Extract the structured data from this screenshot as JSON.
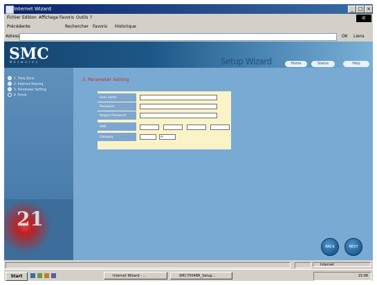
{
  "window": {
    "title": "Internet Wizard",
    "min": "_",
    "max": "□",
    "close": "×"
  },
  "menu": [
    "Fichier",
    "Edition",
    "Affichage",
    "Favoris",
    "Outils",
    "?"
  ],
  "ie_badge": "IE",
  "toolbar": {
    "back": "Précédente",
    "search": "Rechercher",
    "favorites": "Favoris",
    "history": "Historique"
  },
  "address": {
    "label": "Adresse",
    "go": "OK",
    "links": "Liens"
  },
  "banner": {
    "logo": "SMC",
    "subtitle": "Networks",
    "setup_title": "Setup Wizard",
    "tabs": [
      "Home",
      "Status",
      "Help"
    ]
  },
  "steps": [
    {
      "label": "1. Time Zone"
    },
    {
      "label": "2. Internet Sharing"
    },
    {
      "label": "3. Parameter Setting"
    },
    {
      "label": "4. Finish"
    }
  ],
  "page": {
    "heading": "3. Parameter Setting"
  },
  "form": {
    "fields": [
      {
        "label": "User name",
        "value": ""
      },
      {
        "label": "Password",
        "value": ""
      },
      {
        "label": "Retype Password",
        "value": ""
      }
    ],
    "dns_label": "DNS",
    "gateway_label": "Gateway",
    "gateway_value": "m"
  },
  "nav": {
    "back": "BACK",
    "next": "NEXT"
  },
  "status": {
    "zone": "Internet"
  },
  "taskbar": {
    "start": "Start",
    "tasks": [
      "Internet Wizard - ...",
      "SMC7004BR_Setup..."
    ],
    "clock": "15:08"
  }
}
